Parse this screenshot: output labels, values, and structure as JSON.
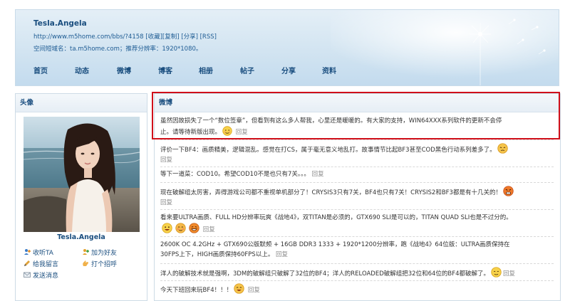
{
  "header": {
    "username": "Tesla.Angela",
    "url": "http://www.m5home.com/bbs/?4158",
    "url_actions": [
      "[收藏]",
      "[复制]",
      "[分享]",
      "[RSS]"
    ],
    "domain_line": "空间短域名：ta.m5home.com；推荐分辨率：1920*1080。",
    "nav": [
      "首页",
      "动态",
      "微博",
      "博客",
      "相册",
      "帖子",
      "分享",
      "资料"
    ]
  },
  "left": {
    "title": "头像",
    "name": "Tesla.Angela",
    "actions": {
      "follow": "收听TA",
      "add_friend": "加为好友",
      "leave_message": "给我留言",
      "greet": "打个招呼",
      "send_message": "发送消息"
    }
  },
  "right": {
    "title": "微博",
    "reply_label": "回复",
    "posts": [
      {
        "line1": "虽然因故损失了一个“数位签章”，但看到有这么多人帮我，心里还是暖暖的。有大家的支持，WIN64XXX系列软件的更新不会停",
        "line2": "止。请等待新版出现。"
      },
      {
        "line1": "评价一下BF4：画质精美，逻辑混乱。感觉在打CS，属于毫无意义地乱打。故事情节比起BF3甚至COD黑色行动系列差多了。"
      },
      {
        "line1": "等下一道菜：COD10。希望COD10不是也只有7关。。。"
      },
      {
        "line1": "现在破解组太厉害，弄得游戏公司都不重视单机部分了！CRYSIS3只有7关，BF4也只有7关！CRYSIS2和BF3都是有十几关的！"
      },
      {
        "line1": "看来要ULTRA画质、FULL HD分辨率玩爽《战地4》，双TITAN是必须的，GTX690 SLI是可以的，TITAN QUAD SLI也是不过分的。"
      },
      {
        "line1": "2600K OC 4.2GHz + GTX690公版默频 + 16GB DDR3 1333 + 1920*1200分辨率，跑《战地4》64位版：ULTRA画质保持在",
        "line2": "30FPS上下，HIGH画质保持60FPS以上。"
      },
      {
        "line1": "洋人的破解技术就是强啊，3DM的破解组只破解了32位的BF4；洋人的RELOADED破解组把32位和64位的BF4都破解了。"
      },
      {
        "line1": "今天下班回来玩BF4！！！"
      }
    ]
  },
  "colors": {
    "link": "#1a4e7f",
    "highlight_border": "#d0101a",
    "reply": "#8a8a8a"
  }
}
